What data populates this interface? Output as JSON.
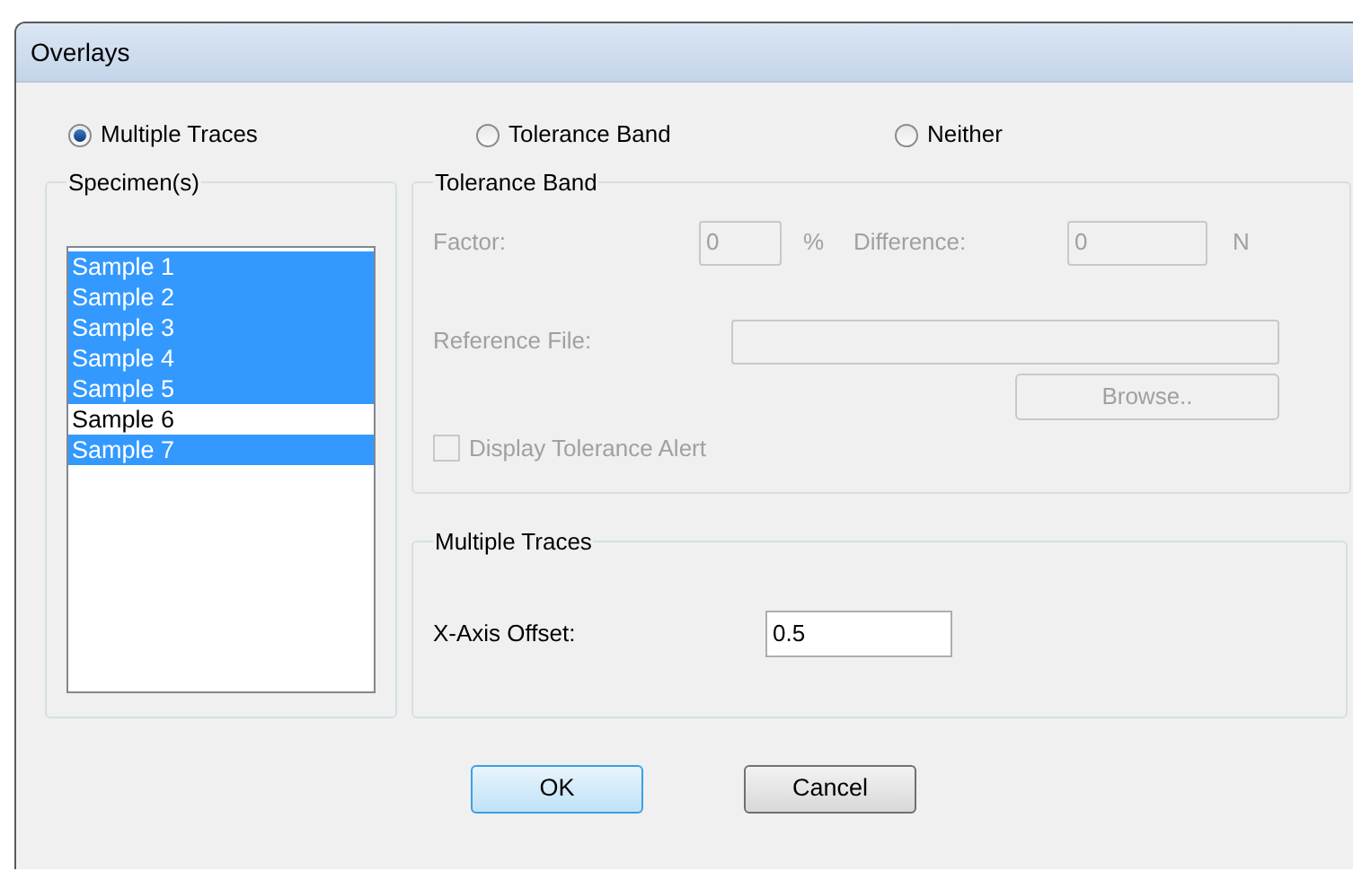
{
  "window": {
    "title": "Overlays"
  },
  "mode_options": [
    {
      "label": "Multiple Traces",
      "selected": true
    },
    {
      "label": "Tolerance Band",
      "selected": false
    },
    {
      "label": "Neither",
      "selected": false
    }
  ],
  "specimens": {
    "title": "Specimen(s)",
    "items": [
      {
        "label": "Sample 1",
        "selected": true
      },
      {
        "label": "Sample 2",
        "selected": true
      },
      {
        "label": "Sample 3",
        "selected": true
      },
      {
        "label": "Sample 4",
        "selected": true
      },
      {
        "label": "Sample 5",
        "selected": true
      },
      {
        "label": "Sample 6",
        "selected": false
      },
      {
        "label": "Sample 7",
        "selected": true
      }
    ]
  },
  "tolerance_band": {
    "title": "Tolerance Band",
    "disabled": true,
    "factor": {
      "label": "Factor:",
      "value": "0",
      "unit": "%"
    },
    "difference": {
      "label": "Difference:",
      "value": "0",
      "unit": "N"
    },
    "reference_file": {
      "label": "Reference File:"
    },
    "browse_button": "Browse..",
    "alert_checkbox": {
      "label": "Display Tolerance Alert",
      "checked": false
    }
  },
  "multiple_traces": {
    "title": "Multiple Traces",
    "x_axis_offset": {
      "label": "X-Axis Offset:",
      "value": "0.5"
    }
  },
  "buttons": [
    {
      "label": "OK",
      "default": true
    },
    {
      "label": "Cancel",
      "default": false
    }
  ]
}
